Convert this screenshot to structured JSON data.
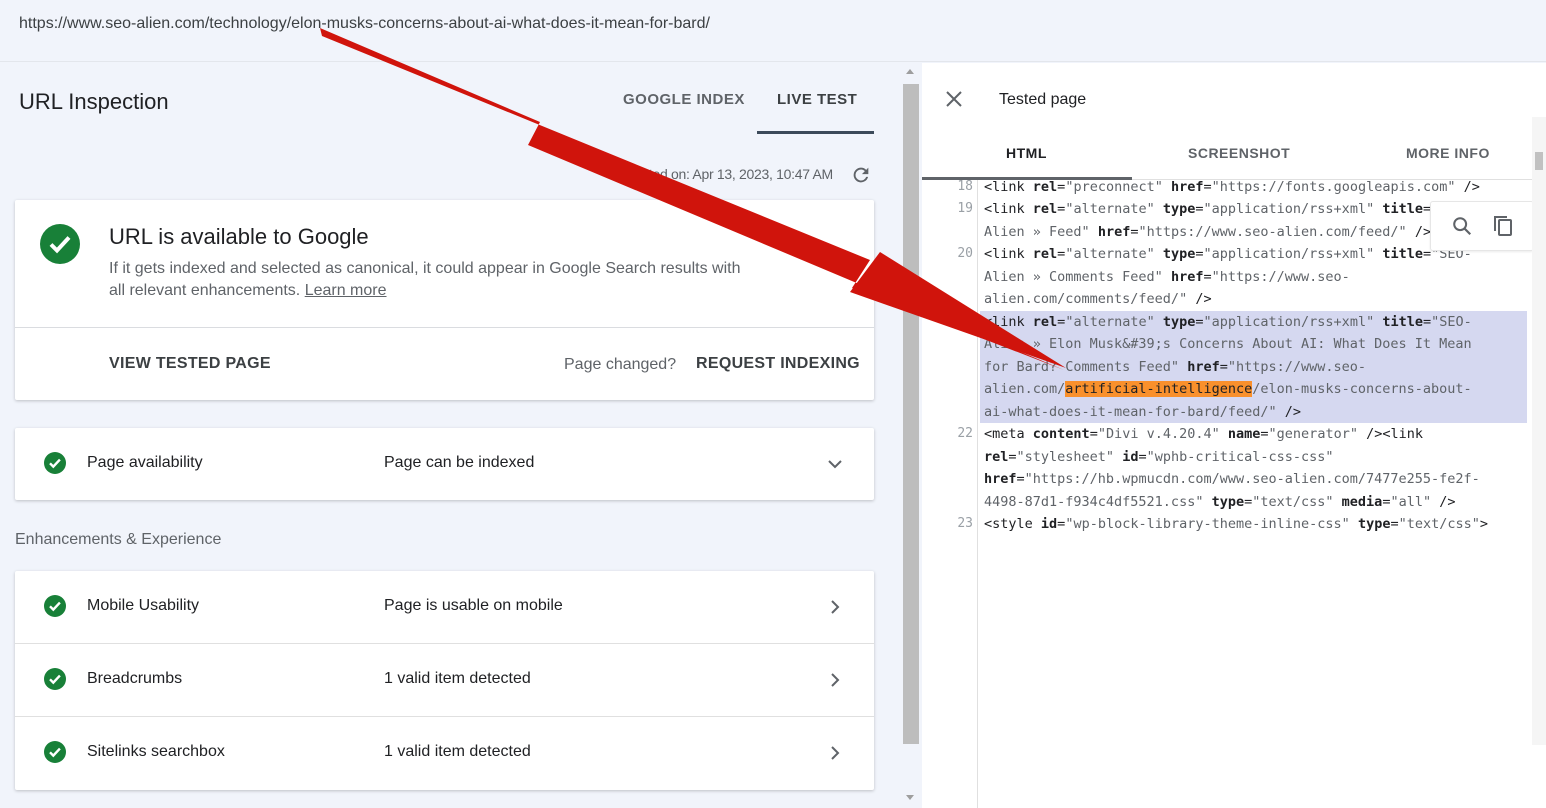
{
  "address_bar": {
    "url": "https://www.seo-alien.com/technology/elon-musks-concerns-about-ai-what-does-it-mean-for-bard/"
  },
  "inspection": {
    "title": "URL Inspection",
    "tabs": [
      "GOOGLE INDEX",
      "LIVE TEST"
    ],
    "active_tab": "LIVE TEST",
    "tested_on": "Tested on: Apr 13, 2023, 10:47 AM"
  },
  "status_card": {
    "title": "URL is available to Google",
    "description": "If it gets indexed and selected as canonical, it could appear in Google Search results with all relevant enhancements.",
    "learn_more": "Learn more",
    "view_tested_page": "VIEW TESTED PAGE",
    "page_changed": "Page changed?",
    "request_indexing": "REQUEST INDEXING"
  },
  "availability": {
    "label": "Page availability",
    "value": "Page can be indexed"
  },
  "enhancements": {
    "section_title": "Enhancements & Experience",
    "rows": [
      {
        "label": "Mobile Usability",
        "value": "Page is usable on mobile"
      },
      {
        "label": "Breadcrumbs",
        "value": "1 valid item detected"
      },
      {
        "label": "Sitelinks searchbox",
        "value": "1 valid item detected"
      }
    ]
  },
  "tested_page": {
    "title": "Tested page",
    "tabs": [
      "HTML",
      "SCREENSHOT",
      "MORE INFO"
    ],
    "active_tab": "HTML",
    "line_numbers": [
      "18",
      "19",
      "20",
      "21",
      "22",
      "23"
    ],
    "highlight_term": "artificial-intelligence"
  },
  "colors": {
    "check_green": "#188038",
    "highlight": "#d5d8f0",
    "term_highlight": "#f9902c",
    "arrow": "#d0140c"
  }
}
